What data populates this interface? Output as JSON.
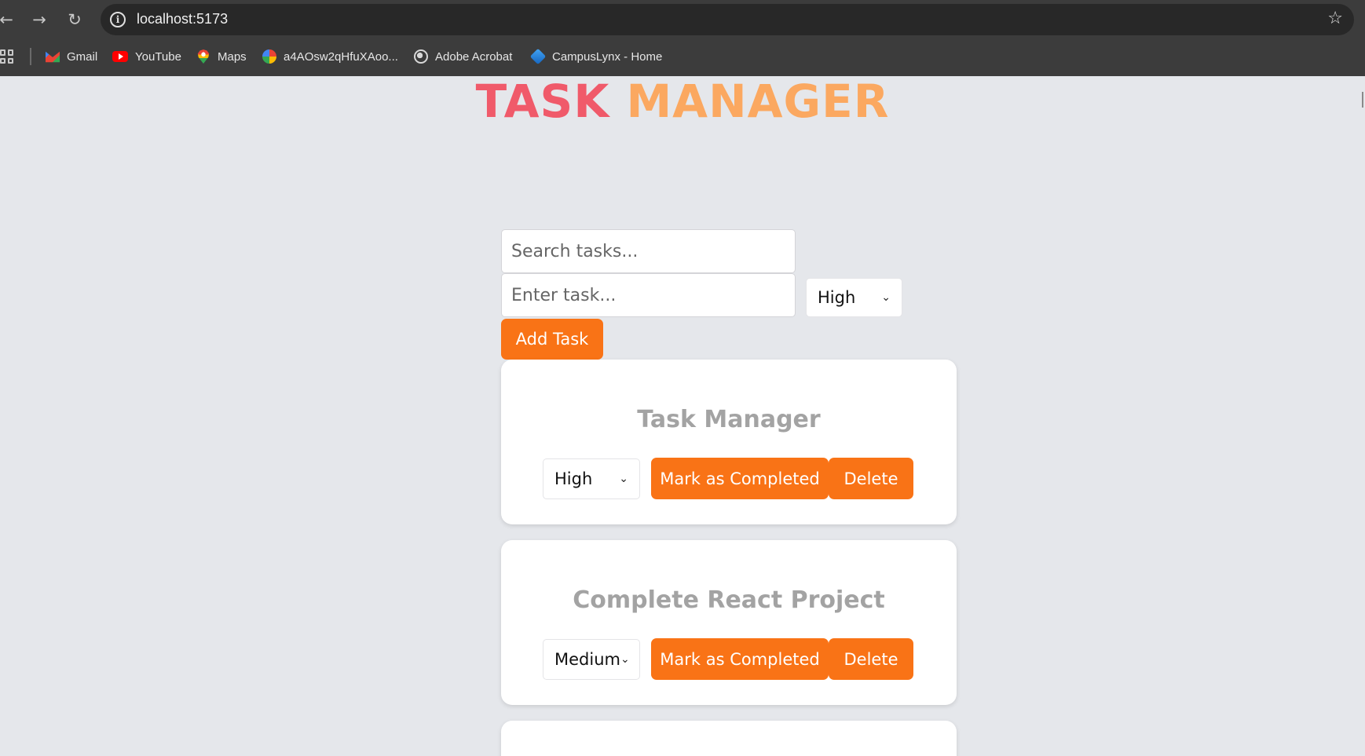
{
  "browser": {
    "url": "localhost:5173",
    "bookmarks": [
      {
        "label": "Gmail",
        "icon": "gmail-icon"
      },
      {
        "label": "YouTube",
        "icon": "youtube-icon"
      },
      {
        "label": "Maps",
        "icon": "maps-icon"
      },
      {
        "label": "a4AOsw2qHfuXAoo...",
        "icon": "photos-icon"
      },
      {
        "label": "Adobe Acrobat",
        "icon": "globe-icon"
      },
      {
        "label": "CampusLynx - Home",
        "icon": "campuslynx-icon"
      }
    ]
  },
  "app": {
    "title_part1": "TASK",
    "title_part2": "MANAGER",
    "title_colors": [
      "#f05a6a",
      "#fba860"
    ],
    "accent": "#f97316",
    "search_placeholder": "Search tasks...",
    "task_placeholder": "Enter task...",
    "priority_selected": "High",
    "add_label": "Add Task"
  },
  "tasks": [
    {
      "title": "Task Manager",
      "priority": "High",
      "complete_label": "Mark as Completed",
      "delete_label": "Delete"
    },
    {
      "title": "Complete React Project",
      "priority": "Medium",
      "complete_label": "Mark as Completed",
      "delete_label": "Delete"
    }
  ]
}
